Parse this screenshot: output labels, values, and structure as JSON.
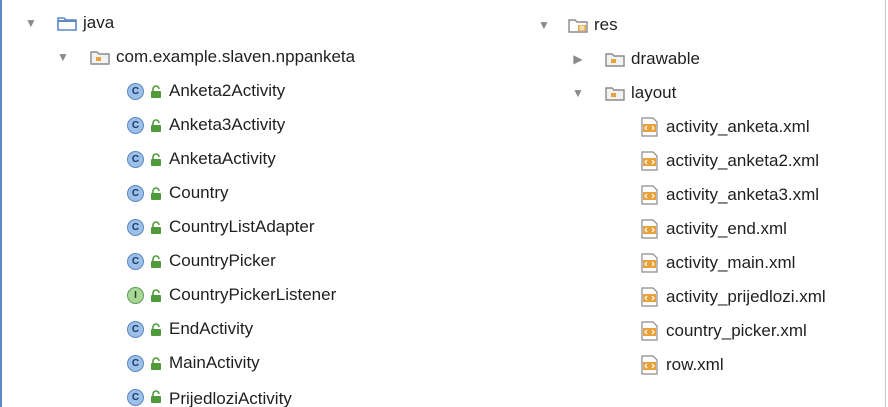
{
  "left_tree": {
    "root": {
      "label": "java",
      "icon": "source-folder-icon"
    },
    "package": {
      "label": "com.example.slaven.nppanketa",
      "icon": "package-folder-icon"
    },
    "items": [
      {
        "label": "Anketa2Activity",
        "kind": "class",
        "badge": "C"
      },
      {
        "label": "Anketa3Activity",
        "kind": "class",
        "badge": "C"
      },
      {
        "label": "AnketaActivity",
        "kind": "class",
        "badge": "C"
      },
      {
        "label": "Country",
        "kind": "class",
        "badge": "C"
      },
      {
        "label": "CountryListAdapter",
        "kind": "class",
        "badge": "C"
      },
      {
        "label": "CountryPicker",
        "kind": "class",
        "badge": "C"
      },
      {
        "label": "CountryPickerListener",
        "kind": "interface",
        "badge": "I"
      },
      {
        "label": "EndActivity",
        "kind": "class",
        "badge": "C"
      },
      {
        "label": "MainActivity",
        "kind": "class",
        "badge": "C"
      },
      {
        "label": "PrijedloziActivity",
        "kind": "class",
        "badge": "C"
      }
    ]
  },
  "right_tree": {
    "root": {
      "label": "res",
      "icon": "resources-folder-icon"
    },
    "folders": [
      {
        "label": "drawable",
        "expanded": false
      },
      {
        "label": "layout",
        "expanded": true
      }
    ],
    "layout_files": [
      "activity_anketa.xml",
      "activity_anketa2.xml",
      "activity_anketa3.xml",
      "activity_end.xml",
      "activity_main.xml",
      "activity_prijedlozi.xml",
      "country_picker.xml",
      "row.xml"
    ]
  },
  "colors": {
    "class_badge": "#9dc0e8",
    "interface_badge": "#a9d79a",
    "lock": "#4f9a3a",
    "folder_blue": "#5b88c3",
    "xml_orange": "#e7a23c"
  }
}
